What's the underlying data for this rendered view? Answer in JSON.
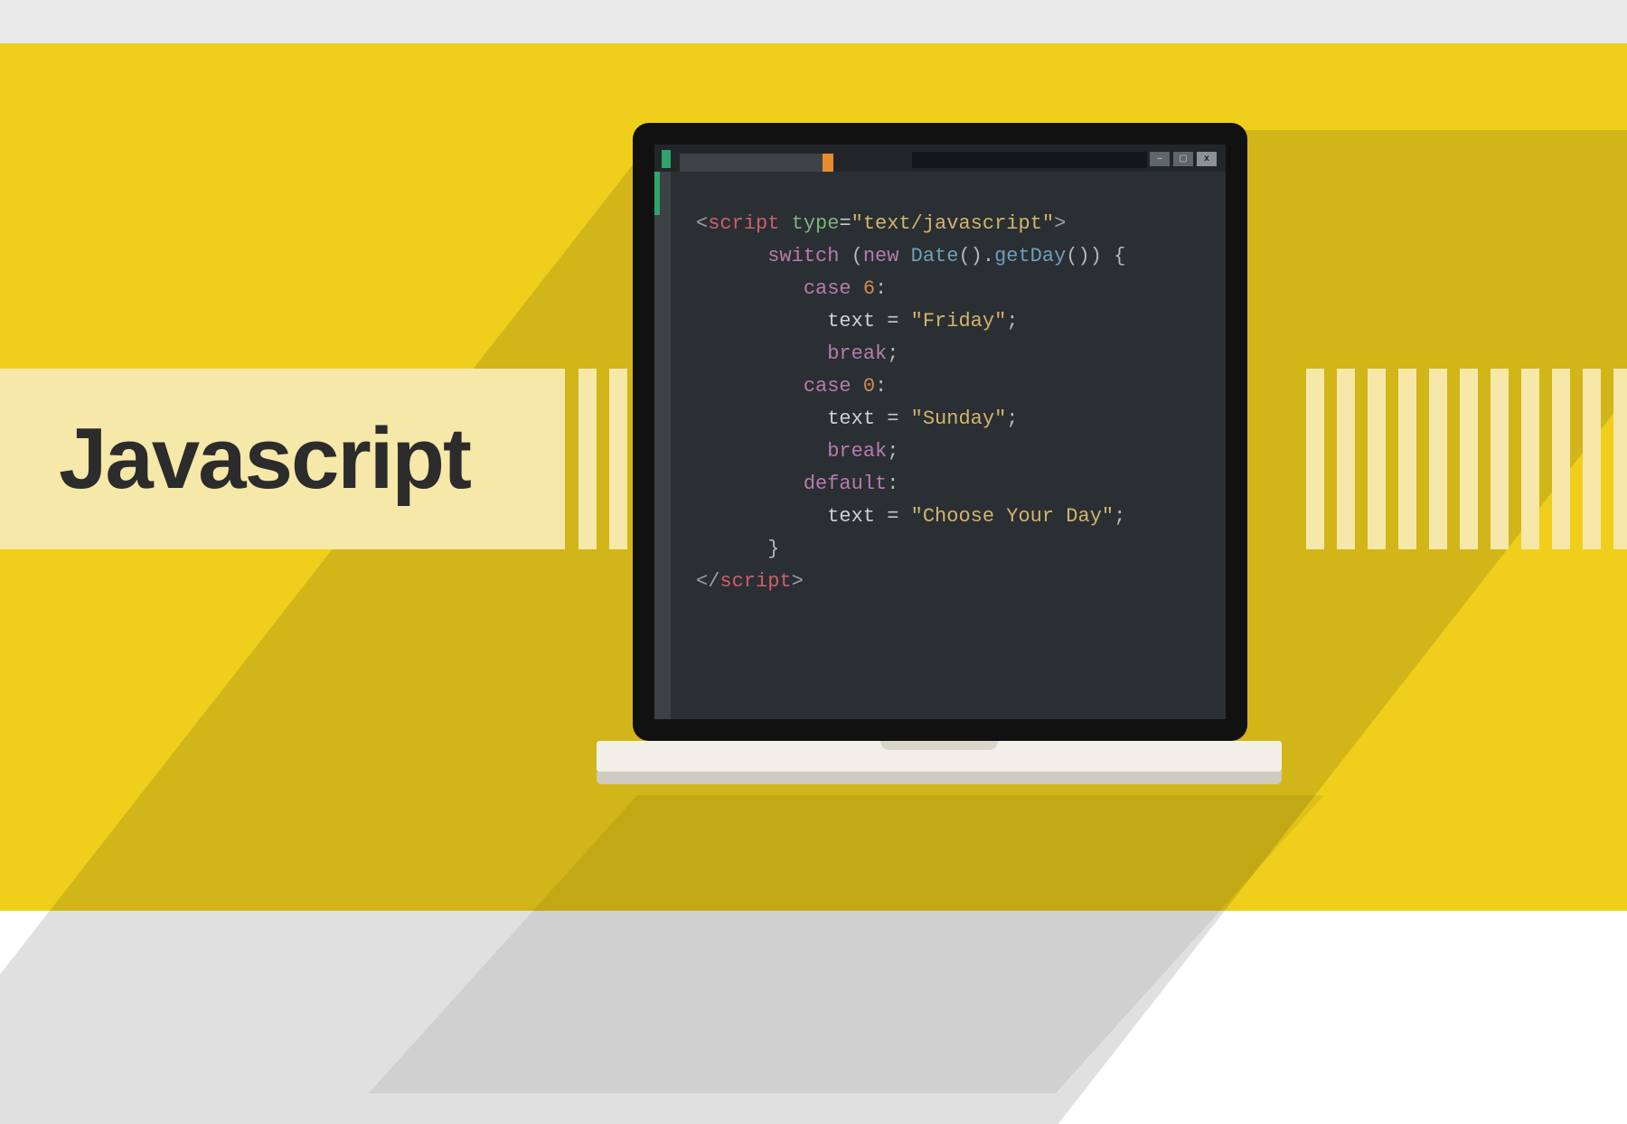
{
  "title": "Javascript",
  "window": {
    "minimize_glyph": "–",
    "maximize_glyph": "▢",
    "close_glyph": "x"
  },
  "code": {
    "script_open_tag": "script",
    "script_attr_name": "type",
    "script_attr_eq": "=",
    "script_attr_value": "\"text/javascript\"",
    "switch_kw": "switch",
    "switch_open": " (",
    "new_kw": "new",
    "date_call": " Date",
    "date_parens": "().",
    "getday_call": "getDay",
    "getday_parens": "())",
    "brace_open": " {",
    "case_kw_1": "case",
    "case_val_1": " 6",
    "colon": ":",
    "text_ident": "text",
    "assign": " = ",
    "friday": "\"Friday\"",
    "semi": ";",
    "break_kw": "break",
    "case_kw_2": "case",
    "case_val_2": " 0",
    "sunday": "\"Sunday\"",
    "default_kw": "default",
    "choose": "\"Choose Your Day\"",
    "brace_close": "}",
    "script_close_tag": "script"
  }
}
